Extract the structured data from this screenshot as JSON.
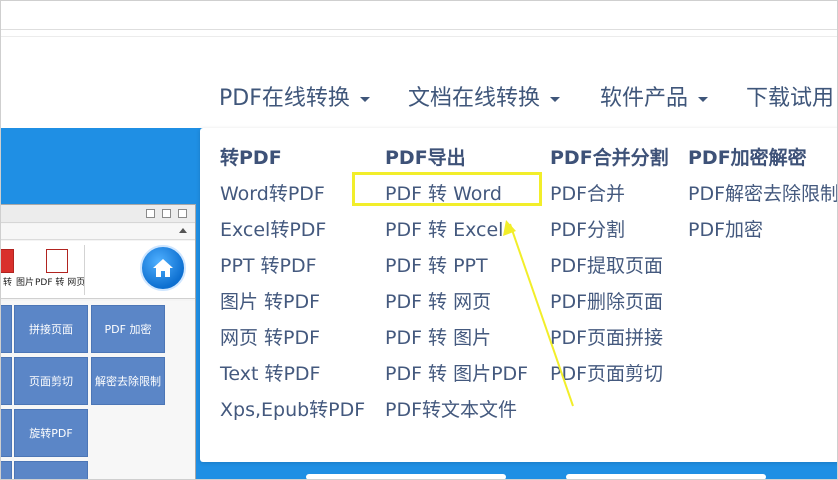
{
  "nav": {
    "items": [
      {
        "label": "PDF在线转换",
        "has_caret": true
      },
      {
        "label": "文档在线转换",
        "has_caret": true
      },
      {
        "label": "软件产品",
        "has_caret": true
      },
      {
        "label": "下载试用",
        "has_caret": false
      }
    ]
  },
  "dropdown": {
    "columns": [
      {
        "title": "转PDF",
        "items": [
          "Word转PDF",
          "Excel转PDF",
          "PPT 转PDF",
          "图片 转PDF",
          "网页 转PDF",
          "Text 转PDF",
          "Xps,Epub转PDF"
        ]
      },
      {
        "title": "PDF导出",
        "items": [
          "PDF 转 Word",
          "PDF 转 Excel",
          "PDF 转 PPT",
          "PDF 转 网页",
          "PDF 转 图片",
          "PDF 转 图片PDF",
          "PDF转文本文件"
        ]
      },
      {
        "title": "PDF合并分割",
        "items": [
          "PDF合并",
          "PDF分割",
          "PDF提取页面",
          "PDF删除页面",
          "PDF页面拼接",
          "PDF页面剪切"
        ]
      },
      {
        "title": "PDF加密解密",
        "items": [
          "PDF解密去除限制",
          "PDF加密"
        ]
      }
    ],
    "highlighted_item": "PDF 转 Word"
  },
  "app_window": {
    "toolbar_labels": [
      "转",
      "图片",
      "PDF 转 网页"
    ],
    "tiles": [
      "拼接页面",
      "PDF 加密",
      "页面剪切",
      "解密去除限制",
      "旋转PDF"
    ]
  },
  "colors": {
    "accent_blue": "#1f8fe4",
    "nav_text": "#3f567a",
    "highlight": "#f2ee2a",
    "tile_blue": "#5b86c7"
  },
  "icons": [
    "caret-down-icon",
    "home-icon",
    "pdf-icon",
    "arrow-annotation-icon"
  ]
}
